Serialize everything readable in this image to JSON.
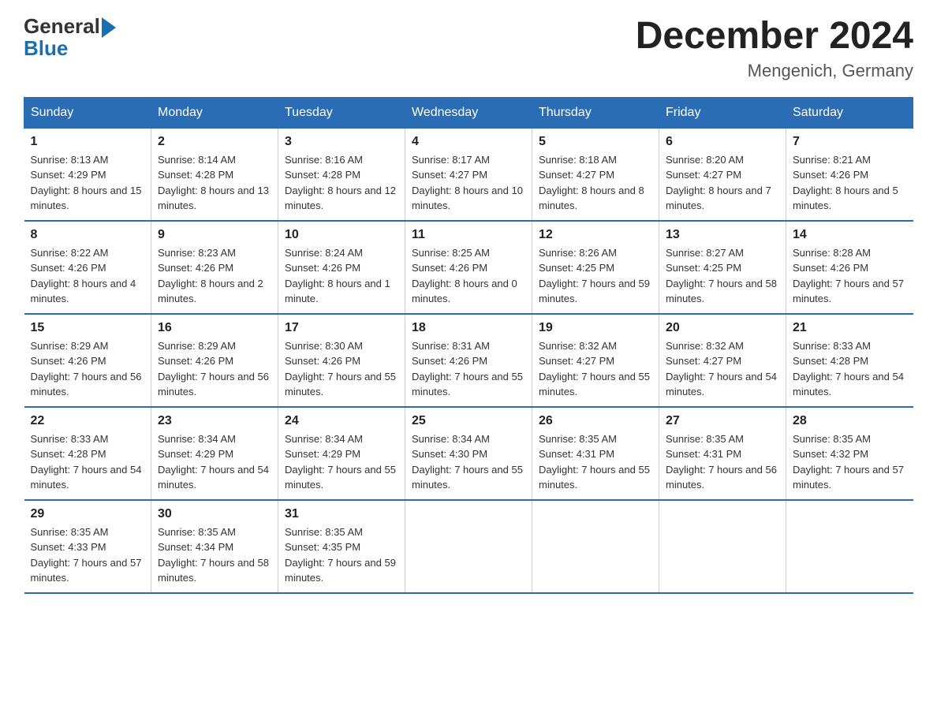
{
  "header": {
    "logo_line1": "General",
    "logo_line2": "Blue",
    "month_title": "December 2024",
    "location": "Mengenich, Germany"
  },
  "days_of_week": [
    "Sunday",
    "Monday",
    "Tuesday",
    "Wednesday",
    "Thursday",
    "Friday",
    "Saturday"
  ],
  "weeks": [
    [
      {
        "day": "1",
        "sunrise": "8:13 AM",
        "sunset": "4:29 PM",
        "daylight": "8 hours and 15 minutes."
      },
      {
        "day": "2",
        "sunrise": "8:14 AM",
        "sunset": "4:28 PM",
        "daylight": "8 hours and 13 minutes."
      },
      {
        "day": "3",
        "sunrise": "8:16 AM",
        "sunset": "4:28 PM",
        "daylight": "8 hours and 12 minutes."
      },
      {
        "day": "4",
        "sunrise": "8:17 AM",
        "sunset": "4:27 PM",
        "daylight": "8 hours and 10 minutes."
      },
      {
        "day": "5",
        "sunrise": "8:18 AM",
        "sunset": "4:27 PM",
        "daylight": "8 hours and 8 minutes."
      },
      {
        "day": "6",
        "sunrise": "8:20 AM",
        "sunset": "4:27 PM",
        "daylight": "8 hours and 7 minutes."
      },
      {
        "day": "7",
        "sunrise": "8:21 AM",
        "sunset": "4:26 PM",
        "daylight": "8 hours and 5 minutes."
      }
    ],
    [
      {
        "day": "8",
        "sunrise": "8:22 AM",
        "sunset": "4:26 PM",
        "daylight": "8 hours and 4 minutes."
      },
      {
        "day": "9",
        "sunrise": "8:23 AM",
        "sunset": "4:26 PM",
        "daylight": "8 hours and 2 minutes."
      },
      {
        "day": "10",
        "sunrise": "8:24 AM",
        "sunset": "4:26 PM",
        "daylight": "8 hours and 1 minute."
      },
      {
        "day": "11",
        "sunrise": "8:25 AM",
        "sunset": "4:26 PM",
        "daylight": "8 hours and 0 minutes."
      },
      {
        "day": "12",
        "sunrise": "8:26 AM",
        "sunset": "4:25 PM",
        "daylight": "7 hours and 59 minutes."
      },
      {
        "day": "13",
        "sunrise": "8:27 AM",
        "sunset": "4:25 PM",
        "daylight": "7 hours and 58 minutes."
      },
      {
        "day": "14",
        "sunrise": "8:28 AM",
        "sunset": "4:26 PM",
        "daylight": "7 hours and 57 minutes."
      }
    ],
    [
      {
        "day": "15",
        "sunrise": "8:29 AM",
        "sunset": "4:26 PM",
        "daylight": "7 hours and 56 minutes."
      },
      {
        "day": "16",
        "sunrise": "8:29 AM",
        "sunset": "4:26 PM",
        "daylight": "7 hours and 56 minutes."
      },
      {
        "day": "17",
        "sunrise": "8:30 AM",
        "sunset": "4:26 PM",
        "daylight": "7 hours and 55 minutes."
      },
      {
        "day": "18",
        "sunrise": "8:31 AM",
        "sunset": "4:26 PM",
        "daylight": "7 hours and 55 minutes."
      },
      {
        "day": "19",
        "sunrise": "8:32 AM",
        "sunset": "4:27 PM",
        "daylight": "7 hours and 55 minutes."
      },
      {
        "day": "20",
        "sunrise": "8:32 AM",
        "sunset": "4:27 PM",
        "daylight": "7 hours and 54 minutes."
      },
      {
        "day": "21",
        "sunrise": "8:33 AM",
        "sunset": "4:28 PM",
        "daylight": "7 hours and 54 minutes."
      }
    ],
    [
      {
        "day": "22",
        "sunrise": "8:33 AM",
        "sunset": "4:28 PM",
        "daylight": "7 hours and 54 minutes."
      },
      {
        "day": "23",
        "sunrise": "8:34 AM",
        "sunset": "4:29 PM",
        "daylight": "7 hours and 54 minutes."
      },
      {
        "day": "24",
        "sunrise": "8:34 AM",
        "sunset": "4:29 PM",
        "daylight": "7 hours and 55 minutes."
      },
      {
        "day": "25",
        "sunrise": "8:34 AM",
        "sunset": "4:30 PM",
        "daylight": "7 hours and 55 minutes."
      },
      {
        "day": "26",
        "sunrise": "8:35 AM",
        "sunset": "4:31 PM",
        "daylight": "7 hours and 55 minutes."
      },
      {
        "day": "27",
        "sunrise": "8:35 AM",
        "sunset": "4:31 PM",
        "daylight": "7 hours and 56 minutes."
      },
      {
        "day": "28",
        "sunrise": "8:35 AM",
        "sunset": "4:32 PM",
        "daylight": "7 hours and 57 minutes."
      }
    ],
    [
      {
        "day": "29",
        "sunrise": "8:35 AM",
        "sunset": "4:33 PM",
        "daylight": "7 hours and 57 minutes."
      },
      {
        "day": "30",
        "sunrise": "8:35 AM",
        "sunset": "4:34 PM",
        "daylight": "7 hours and 58 minutes."
      },
      {
        "day": "31",
        "sunrise": "8:35 AM",
        "sunset": "4:35 PM",
        "daylight": "7 hours and 59 minutes."
      },
      null,
      null,
      null,
      null
    ]
  ]
}
